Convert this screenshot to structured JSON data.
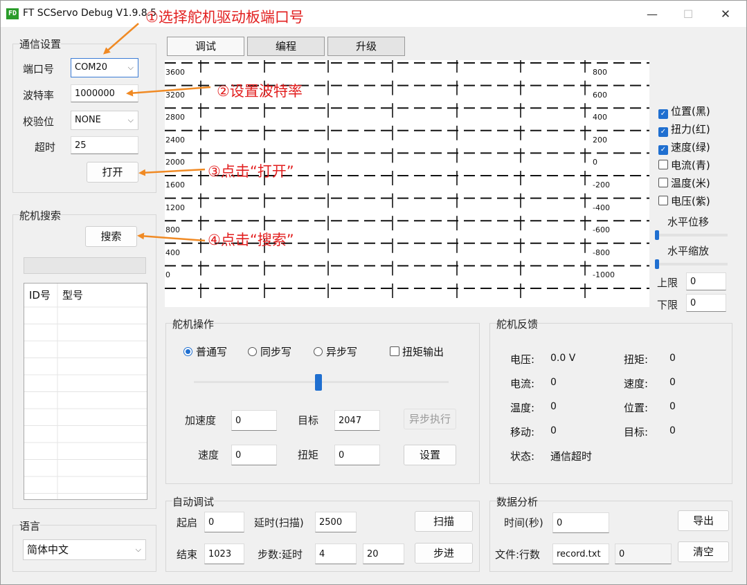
{
  "window": {
    "icon_text": "FD",
    "title": "FT SCServo Debug V1.9.8.5",
    "min_glyph": "—",
    "max_glyph": "☐",
    "close_glyph": "✕"
  },
  "comm": {
    "group_title": "通信设置",
    "port_label": "端口号",
    "port_value": "COM20",
    "baud_label": "波特率",
    "baud_value": "1000000",
    "parity_label": "校验位",
    "parity_value": "NONE",
    "timeout_label": "超时",
    "timeout_value": "25",
    "open_button": "打开"
  },
  "search": {
    "group_title": "舵机搜索",
    "search_button": "搜索",
    "list_headers": [
      "ID号",
      "型号"
    ]
  },
  "language": {
    "group_title": "语言",
    "value": "简体中文"
  },
  "tabs": [
    "调试",
    "编程",
    "升级"
  ],
  "plot": {
    "left_ticks": [
      "3600",
      "3200",
      "2800",
      "2400",
      "2000",
      "1600",
      "1200",
      "800",
      "400",
      "0"
    ],
    "right_ticks": [
      "800",
      "600",
      "400",
      "200",
      "0",
      "-200",
      "-400",
      "-600",
      "-800",
      "-1000"
    ]
  },
  "plot_controls": {
    "checks": [
      {
        "label": "位置(黑)",
        "checked": true
      },
      {
        "label": "扭力(红)",
        "checked": true
      },
      {
        "label": "速度(绿)",
        "checked": true
      },
      {
        "label": "电流(青)",
        "checked": false
      },
      {
        "label": "温度(米)",
        "checked": false
      },
      {
        "label": "电压(紫)",
        "checked": false
      }
    ],
    "hshift_label": "水平位移",
    "hzoom_label": "水平缩放",
    "upper_label": "上限",
    "upper_value": "0",
    "lower_label": "下限",
    "lower_value": "0",
    "check_mark": "✓"
  },
  "servo_op": {
    "group_title": "舵机操作",
    "radios": [
      {
        "label": "普通写",
        "selected": true
      },
      {
        "label": "同步写",
        "selected": false
      },
      {
        "label": "异步写",
        "selected": false
      }
    ],
    "torque_out_label": "扭矩输出",
    "accel_label": "加速度",
    "accel_value": "0",
    "target_label": "目标",
    "target_value": "2047",
    "async_exec_button": "异步执行",
    "speed_label": "速度",
    "speed_value": "0",
    "torque_label": "扭矩",
    "torque_value": "0",
    "set_button": "设置",
    "slider_position": 0.49
  },
  "feedback": {
    "group_title": "舵机反馈",
    "voltage_label": "电压:",
    "voltage_value": "0.0 V",
    "current_label": "电流:",
    "current_value": "0",
    "temp_label": "温度:",
    "temp_value": "0",
    "move_label": "移动:",
    "move_value": "0",
    "status_label": "状态:",
    "status_value": "通信超时",
    "torque_label": "扭矩:",
    "torque_value": "0",
    "speed_label": "速度:",
    "speed_value": "0",
    "position_label": "位置:",
    "position_value": "0",
    "target_label": "目标:",
    "target_value": "0"
  },
  "auto": {
    "group_title": "自动调试",
    "start_label": "起启",
    "start_value": "0",
    "delay_label": "延时(扫描)",
    "delay_value": "2500",
    "scan_button": "扫描",
    "end_label": "结束",
    "end_value": "1023",
    "step_label": "步数:延时",
    "step_value": "4",
    "step_delay_value": "20",
    "step_button": "步进"
  },
  "analysis": {
    "group_title": "数据分析",
    "time_label": "时间(秒)",
    "time_value": "0",
    "export_button": "导出",
    "file_label": "文件:行数",
    "file_value": "record.txt",
    "rows_value": "0",
    "clear_button": "清空"
  },
  "annotations": {
    "step1": "①选择舵机驱动板端口号",
    "step2": "②设置波特率",
    "step3": "③点击“打开”",
    "step4": "④点击“搜索”",
    "color": "#e21f1f",
    "arrow_color": "#f08a24"
  }
}
